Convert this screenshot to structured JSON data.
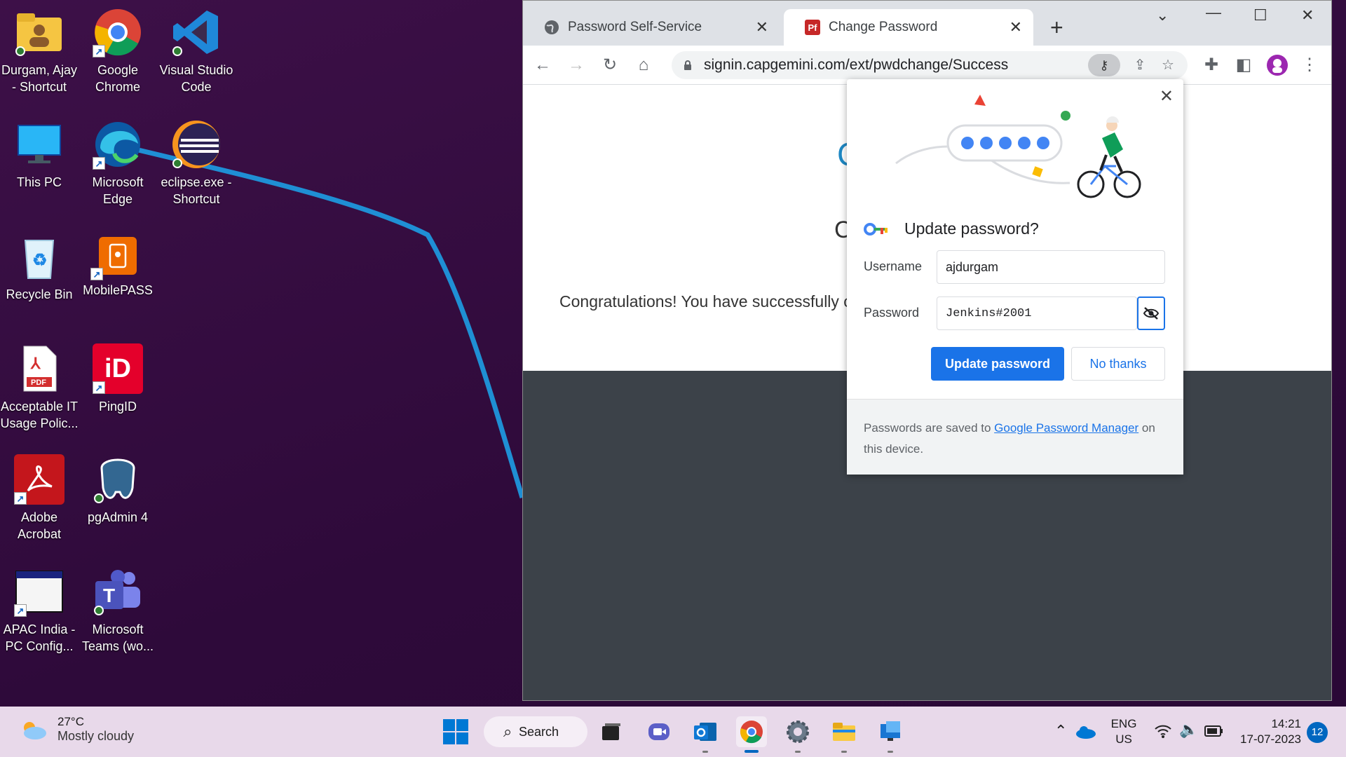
{
  "desktop": {
    "icons": [
      {
        "label_line1": "Durgam, Ajay",
        "label_line2": "- Shortcut",
        "icon": "user-folder-icon"
      },
      {
        "label_line1": "Google",
        "label_line2": "Chrome",
        "icon": "chrome-icon"
      },
      {
        "label_line1": "Visual Studio",
        "label_line2": "Code",
        "icon": "vscode-icon"
      },
      {
        "label_line1": "This PC",
        "label_line2": "",
        "icon": "monitor-icon"
      },
      {
        "label_line1": "Microsoft",
        "label_line2": "Edge",
        "icon": "edge-icon"
      },
      {
        "label_line1": "eclipse.exe -",
        "label_line2": "Shortcut",
        "icon": "eclipse-icon"
      },
      {
        "label_line1": "Recycle Bin",
        "label_line2": "",
        "icon": "recycle-bin-icon"
      },
      {
        "label_line1": "MobilePASS",
        "label_line2": "",
        "icon": "mobilepass-icon"
      },
      {
        "label_line1": "Acceptable IT",
        "label_line2": "Usage Polic...",
        "icon": "pdf-file-icon"
      },
      {
        "label_line1": "PingID",
        "label_line2": "",
        "icon": "pingid-icon"
      },
      {
        "label_line1": "Adobe",
        "label_line2": "Acrobat",
        "icon": "adobe-acrobat-icon"
      },
      {
        "label_line1": "pgAdmin 4",
        "label_line2": "",
        "icon": "pgadmin-icon"
      },
      {
        "label_line1": "APAC India -",
        "label_line2": "PC Config...",
        "icon": "window-app-icon"
      },
      {
        "label_line1": "Microsoft",
        "label_line2": "Teams (wo...",
        "icon": "teams-icon"
      }
    ],
    "pdf_badge": "PDF",
    "pingid_badge": "iD",
    "teams_badge": "T"
  },
  "browser": {
    "tabs": [
      {
        "title": "Password Self-Service",
        "icon": "globe-icon",
        "active": false
      },
      {
        "title": "Change Password",
        "icon": "pf-favicon",
        "favicon_text": "Pf",
        "active": true
      }
    ],
    "url": "signin.capgemini.com/ext/pwdchange/Success",
    "page": {
      "congrats_text": "Congratulations! You have successfully c",
      "partial_char_1": "C",
      "partial_char_2": "C"
    }
  },
  "password_bubble": {
    "title": "Update password?",
    "username_label": "Username",
    "username_value": "ajdurgam",
    "password_label": "Password",
    "password_value": "Jenkins#2001",
    "update_button": "Update password",
    "no_thanks_button": "No thanks",
    "footer_prefix": "Passwords are saved to ",
    "footer_link": "Google Password Manager",
    "footer_suffix": " on this device."
  },
  "taskbar": {
    "weather_temp": "27°C",
    "weather_condition": "Mostly cloudy",
    "search_label": "Search",
    "language_line1": "ENG",
    "language_line2": "US",
    "time": "14:21",
    "date": "17-07-2023",
    "notification_count": "12"
  },
  "colors": {
    "accent_blue": "#1a73e8",
    "desktop_purple": "#3a0f44",
    "taskbar_bg": "#e8d9ea"
  }
}
